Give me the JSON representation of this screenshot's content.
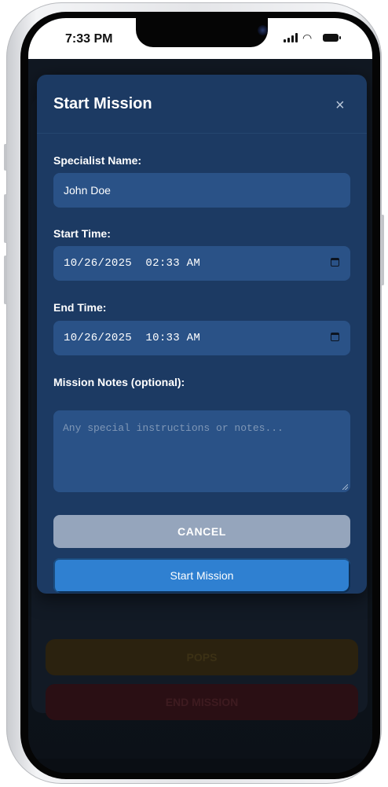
{
  "status_bar": {
    "time": "7:33 PM"
  },
  "background_app": {
    "pops_label": "POPS",
    "end_mission_label": "END MISSION"
  },
  "modal": {
    "title": "Start Mission",
    "close_icon": "×",
    "specialist_name_label": "Specialist Name:",
    "specialist_name_value": "John Doe",
    "start_time_label": "Start Time:",
    "start_time_value": "10/26/2025  02:33 AM",
    "end_time_label": "End Time:",
    "end_time_value": "10/26/2025  10:33 AM",
    "notes_label": "Mission Notes (optional):",
    "notes_placeholder": "Any special instructions or notes...",
    "cancel_label": "CANCEL",
    "start_label": "Start Mission"
  },
  "colors": {
    "modal_bg": "#1c3a63",
    "field_bg": "#2a5287",
    "cancel_bg": "#95a5bc",
    "primary_bg": "#2f80d1"
  },
  "icons": {
    "close": "close-icon",
    "calendar": "calendar-icon",
    "signal": "cellular-signal-icon",
    "wifi": "wifi-icon",
    "battery": "battery-icon"
  }
}
